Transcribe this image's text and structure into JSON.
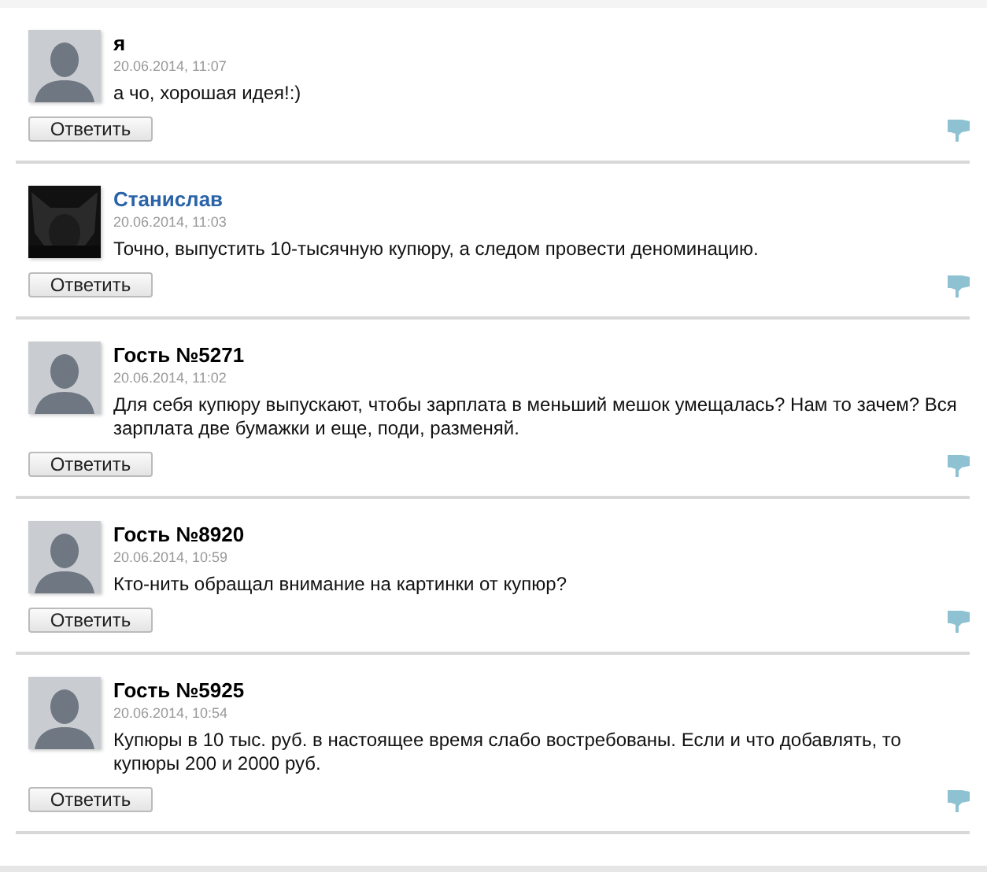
{
  "comments": [
    {
      "kind": "guest",
      "author": "я",
      "date": "20.06.2014, 11:07",
      "text": "а чо, хорошая идея!:)",
      "reply": "Ответить"
    },
    {
      "kind": "user",
      "author": "Станислав",
      "date": "20.06.2014, 11:03",
      "text": "Точно, выпустить 10-тысячную купюру, а следом провести деноминацию.",
      "reply": "Ответить"
    },
    {
      "kind": "guest",
      "author": "Гость №5271",
      "date": "20.06.2014, 11:02",
      "text": "Для себя купюру выпускают, чтобы зарплата в меньший мешок умещалась? Нам то зачем? Вся зарплата две бумажки и еще, поди, разменяй.",
      "reply": "Ответить"
    },
    {
      "kind": "guest",
      "author": "Гость №8920",
      "date": "20.06.2014, 10:59",
      "text": "Кто-нить обращал внимание на картинки от купюр?",
      "reply": "Ответить"
    },
    {
      "kind": "guest",
      "author": "Гость №5925",
      "date": "20.06.2014, 10:54",
      "text": "Купюры в 10 тыс. руб. в настоящее время слабо востребованы. Если и что добавлять, то купюры 200 и 2000 руб.",
      "reply": "Ответить"
    }
  ]
}
